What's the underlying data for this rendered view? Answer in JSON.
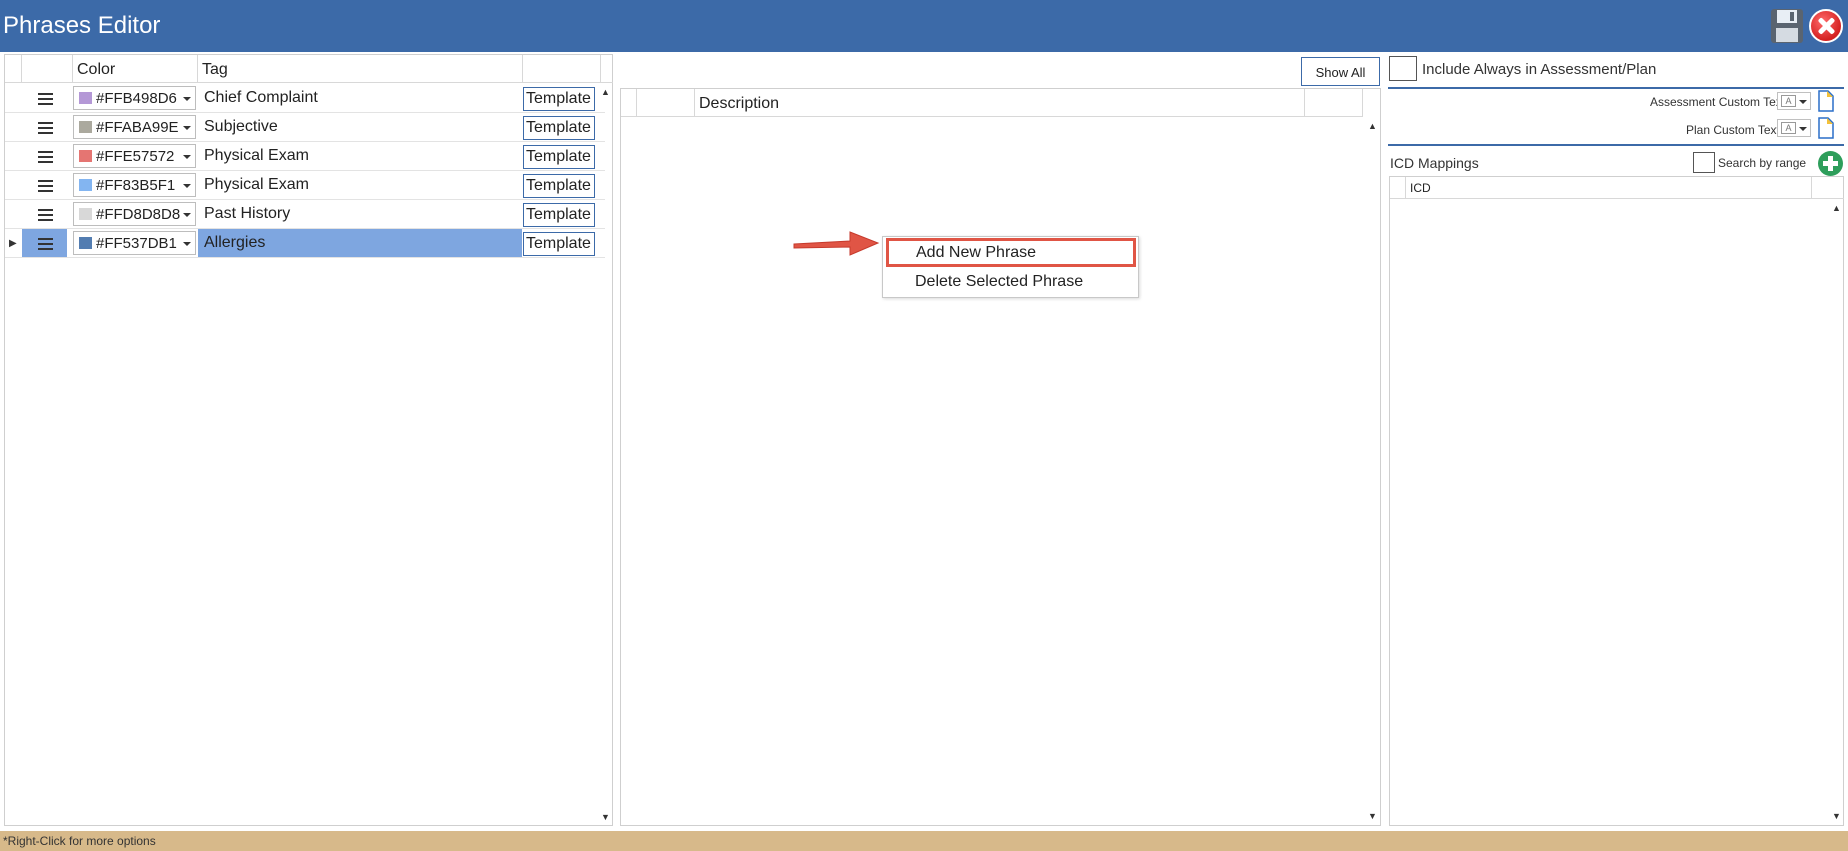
{
  "window": {
    "title": "Phrases Editor"
  },
  "left_grid": {
    "headers": {
      "color": "Color",
      "tag": "Tag"
    },
    "template_label": "Template",
    "rows": [
      {
        "color_hex": "#FFB498D6",
        "swatch": "#b498d6",
        "tag": "Chief Complaint",
        "selected": false
      },
      {
        "color_hex": "#FFABA99E",
        "swatch": "#aba99e",
        "tag": "Subjective",
        "selected": false
      },
      {
        "color_hex": "#FFE57572",
        "swatch": "#e57572",
        "tag": "Physical Exam",
        "selected": false
      },
      {
        "color_hex": "#FF83B5F1",
        "swatch": "#83b5f1",
        "tag": "Physical Exam",
        "selected": false
      },
      {
        "color_hex": "#FFD8D8D8",
        "swatch": "#d8d8d8",
        "tag": "Past History",
        "selected": false
      },
      {
        "color_hex": "#FF537DB1",
        "swatch": "#537db1",
        "tag": "Allergies",
        "selected": true
      }
    ]
  },
  "middle": {
    "show_all_label": "Show All",
    "description_header": "Description",
    "context_menu": {
      "add": "Add New Phrase",
      "delete": "Delete Selected Phrase"
    }
  },
  "right": {
    "include_always": "Include Always in Assessment/Plan",
    "assessment_custom": "Assessment Custom Text:",
    "plan_custom": "Plan Custom Text:",
    "icd_mappings": "ICD Mappings",
    "search_by_range": "Search by range",
    "icd_header": "ICD"
  },
  "status": {
    "text": "*Right-Click for more options"
  },
  "colors": {
    "titlebar": "#3c6aa8",
    "selection": "#7ea6e0",
    "statusbar": "#d7b98a",
    "callout": "#e05545"
  }
}
